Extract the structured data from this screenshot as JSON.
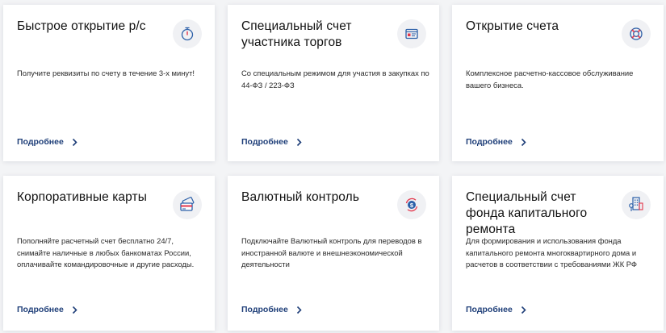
{
  "colors": {
    "link": "#1f3f79",
    "accent_red": "#e3364b",
    "accent_blue": "#2b5fa8",
    "icon_bg": "#f0f1f4",
    "card_bg": "#ffffff"
  },
  "cards": [
    {
      "title": "Быстрое открытие р/с",
      "description": "Получите реквизиты по счету в течение 3-х минут!",
      "link_label": "Подробнее",
      "icon": "stopwatch-icon"
    },
    {
      "title": "Специальный счет участника торгов",
      "description": "Со специальным режимом для участия в закупках по 44-ФЗ / 223-ФЗ",
      "link_label": "Подробнее",
      "icon": "id-card-icon"
    },
    {
      "title": "Открытие счета",
      "description": "Комплексное расчетно-кассовое обслуживание вашего бизнеса.",
      "link_label": "Подробнее",
      "icon": "lifebuoy-icon"
    },
    {
      "title": "Корпоративные карты",
      "description": "Пополняйте расчетный счет бесплатно 24/7, снимайте наличные в любых банкоматах России, оплачивайте командировочные и другие расходы.",
      "link_label": "Подробнее",
      "icon": "cards-icon"
    },
    {
      "title": "Валютный контроль",
      "description": "Подключайте Валютный контроль для переводов в иностранной валюте и внешнеэкономической деятельности",
      "link_label": "Подробнее",
      "icon": "dollar-coin-icon"
    },
    {
      "title": "Специальный счет фонда капитального ремонта",
      "description": "Для формирования и использования фонда капитального ремонта многоквартирного дома и расчетов в соответствии с требованиями ЖК РФ",
      "link_label": "Подробнее",
      "icon": "building-icon"
    }
  ]
}
